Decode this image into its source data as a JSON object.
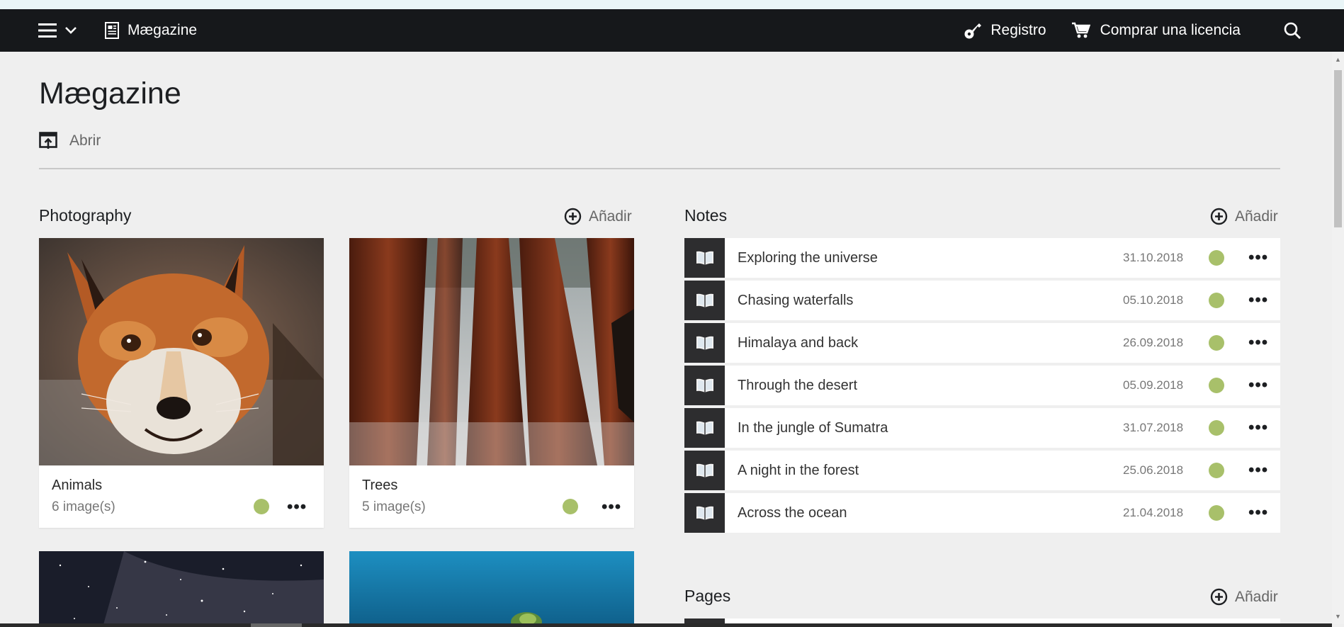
{
  "nav": {
    "menu_icon": "hamburger-icon",
    "title": "Mægazine",
    "register_label": "Registro",
    "buy_label": "Comprar una licencia"
  },
  "header": {
    "title": "Mægazine",
    "open_label": "Abrir"
  },
  "photography": {
    "title": "Photography",
    "add_label": "Añadir",
    "albums": [
      {
        "name": "Animals",
        "count": "6 image(s)",
        "status_color": "#a8c06a"
      },
      {
        "name": "Trees",
        "count": "5 image(s)",
        "status_color": "#a8c06a"
      }
    ]
  },
  "notes": {
    "title": "Notes",
    "add_label": "Añadir",
    "items": [
      {
        "title": "Exploring the universe",
        "date": "31.10.2018"
      },
      {
        "title": "Chasing waterfalls",
        "date": "05.10.2018"
      },
      {
        "title": "Himalaya and back",
        "date": "26.09.2018"
      },
      {
        "title": "Through the desert",
        "date": "05.09.2018"
      },
      {
        "title": "In the jungle of Sumatra",
        "date": "31.07.2018"
      },
      {
        "title": "A night in the forest",
        "date": "25.06.2018"
      },
      {
        "title": "Across the ocean",
        "date": "21.04.2018"
      }
    ]
  },
  "pages": {
    "title": "Pages",
    "add_label": "Añadir"
  },
  "colors": {
    "navbar": "#16181b",
    "status_published": "#a8c06a",
    "background": "#efefef"
  }
}
